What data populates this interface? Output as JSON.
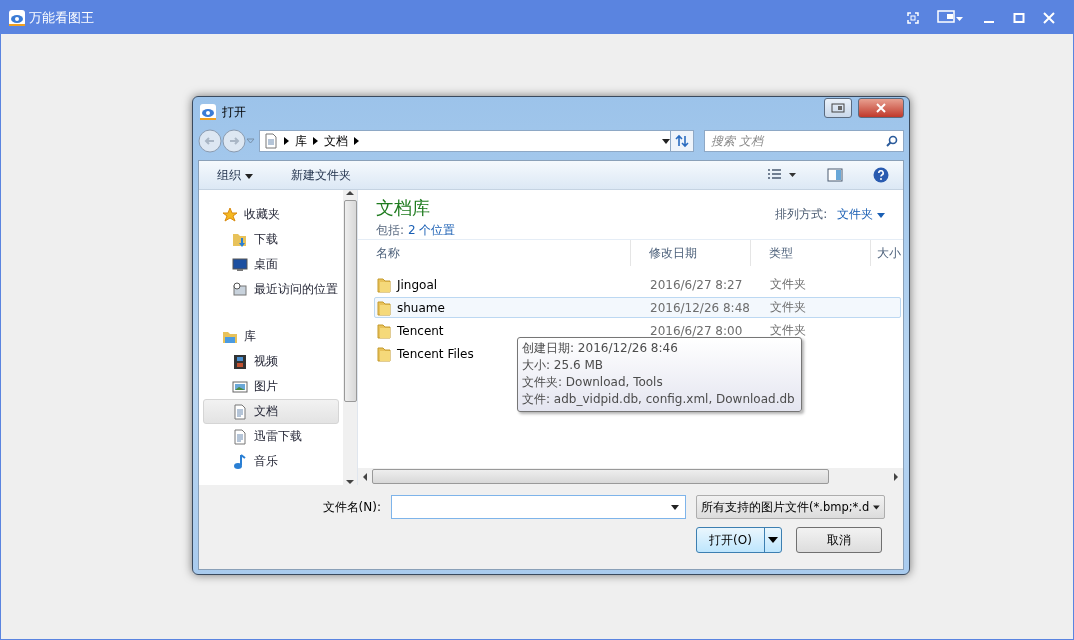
{
  "app": {
    "title": "万能看图王"
  },
  "dialog": {
    "title": "打开",
    "address": {
      "crumbs": [
        "库",
        "文档"
      ]
    },
    "search": {
      "placeholder": "搜索 文档"
    },
    "toolbar": {
      "organize": "组织",
      "new_folder": "新建文件夹"
    },
    "nav": [
      {
        "label": "收藏夹",
        "kind": "star",
        "selected": false,
        "children": [
          {
            "label": "下载",
            "kind": "download",
            "selected": false
          },
          {
            "label": "桌面",
            "kind": "desktop",
            "selected": false
          },
          {
            "label": "最近访问的位置",
            "kind": "recent",
            "selected": false
          }
        ]
      },
      {
        "label": "库",
        "kind": "library",
        "selected": false,
        "children": [
          {
            "label": "视频",
            "kind": "video",
            "selected": false
          },
          {
            "label": "图片",
            "kind": "picture",
            "selected": false
          },
          {
            "label": "文档",
            "kind": "document",
            "selected": true
          },
          {
            "label": "迅雷下载",
            "kind": "document",
            "selected": false
          },
          {
            "label": "音乐",
            "kind": "music",
            "selected": false
          }
        ]
      }
    ],
    "library": {
      "title": "文档库",
      "includes_label": "包括:",
      "includes_link": "2 个位置",
      "arrange_label": "排列方式:",
      "arrange_value": "文件夹"
    },
    "columns": [
      "名称",
      "修改日期",
      "类型",
      "大小"
    ],
    "rows": [
      {
        "name": "Jingoal",
        "date": "2016/6/27 8:27",
        "type": "文件夹",
        "selected": false
      },
      {
        "name": "shuame",
        "date": "2016/12/26 8:48",
        "type": "文件夹",
        "selected": true
      },
      {
        "name": "Tencent",
        "date": "2016/6/27 8:00",
        "type": "文件夹",
        "selected": false
      },
      {
        "name": "Tencent Files",
        "selected": false
      }
    ],
    "tooltip": [
      "创建日期: 2016/12/26 8:46",
      "大小: 25.6 MB",
      "文件夹: Download, Tools",
      "文件: adb_vidpid.db, config.xml, Download.db"
    ],
    "filename": {
      "label": "文件名(N):"
    },
    "filetype": "所有支持的图片文件(*.bmp;*.d",
    "buttons": {
      "open": "打开(O)",
      "cancel": "取消"
    }
  }
}
